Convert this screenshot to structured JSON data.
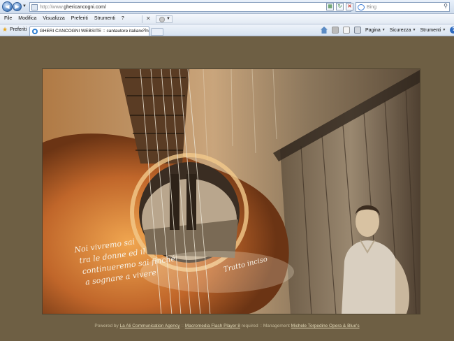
{
  "browser": {
    "url": "http://www.ghericancogni.com/",
    "url_grey_part": "http://www.",
    "url_host_part": "ghericancogni.com/",
    "search_placeholder": "Bing",
    "menu": [
      "File",
      "Modifica",
      "Visualizza",
      "Preferiti",
      "Strumenti",
      "?"
    ],
    "favorites_label": "Preferiti",
    "tab_title": "GHERI CANCOGNI WEBSITE :: cantautore italiano mu...",
    "toolbar_pagina": "Pagina",
    "toolbar_sicurezza": "Sicurezza",
    "toolbar_strumenti": "Strumenti"
  },
  "page": {
    "background_color": "#6e5f44",
    "handwriting": [
      "Noi vivremo sai",
      "tra le donne ed il",
      "continueremo sai finché",
      "a sognare a vivere"
    ],
    "signature": "Tratto inciso",
    "footer": {
      "powered_by": "Powered by",
      "agency": "La Ali Communication Agency",
      "plugin": "Macromedia Flash Player 8",
      "required": "required",
      "management": "Management",
      "management_link": "Michele Torpedine Opera & Blue's"
    }
  }
}
